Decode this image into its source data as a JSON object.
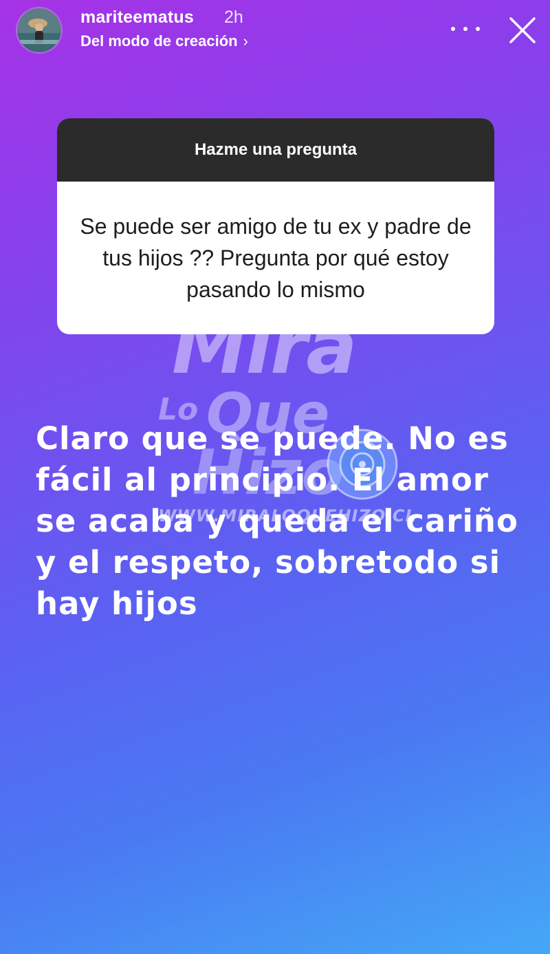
{
  "header": {
    "username": "mariteematus",
    "time_ago": "2h",
    "subtitle": "Del modo de creación",
    "subtitle_chevron": "›",
    "avatar_icon": "profile-photo",
    "more_icon": "more-dots-icon",
    "close_icon": "close-icon"
  },
  "question_sticker": {
    "title": "Hazme una pregunta",
    "question": "Se puede ser amigo de tu ex y padre de tus hijos ?? Pregunta por qué estoy pasando lo mismo"
  },
  "answer_text": "Claro que se puede. No es fácil al principio.  El amor se acaba y queda el cariño y el respeto, sobretodo si hay hijos",
  "watermark": {
    "line1": "Mira",
    "line2a": "Lo",
    "line2b": "Que",
    "line3": "Hizo",
    "url": "WWW.MIRALOQUEHIZO.CL"
  },
  "colors": {
    "gradient_top": "#a632e6",
    "gradient_mid": "#6f52f0",
    "gradient_bottom": "#44a8f6",
    "sticker_header": "#2b2b2b",
    "sticker_body": "#ffffff"
  }
}
